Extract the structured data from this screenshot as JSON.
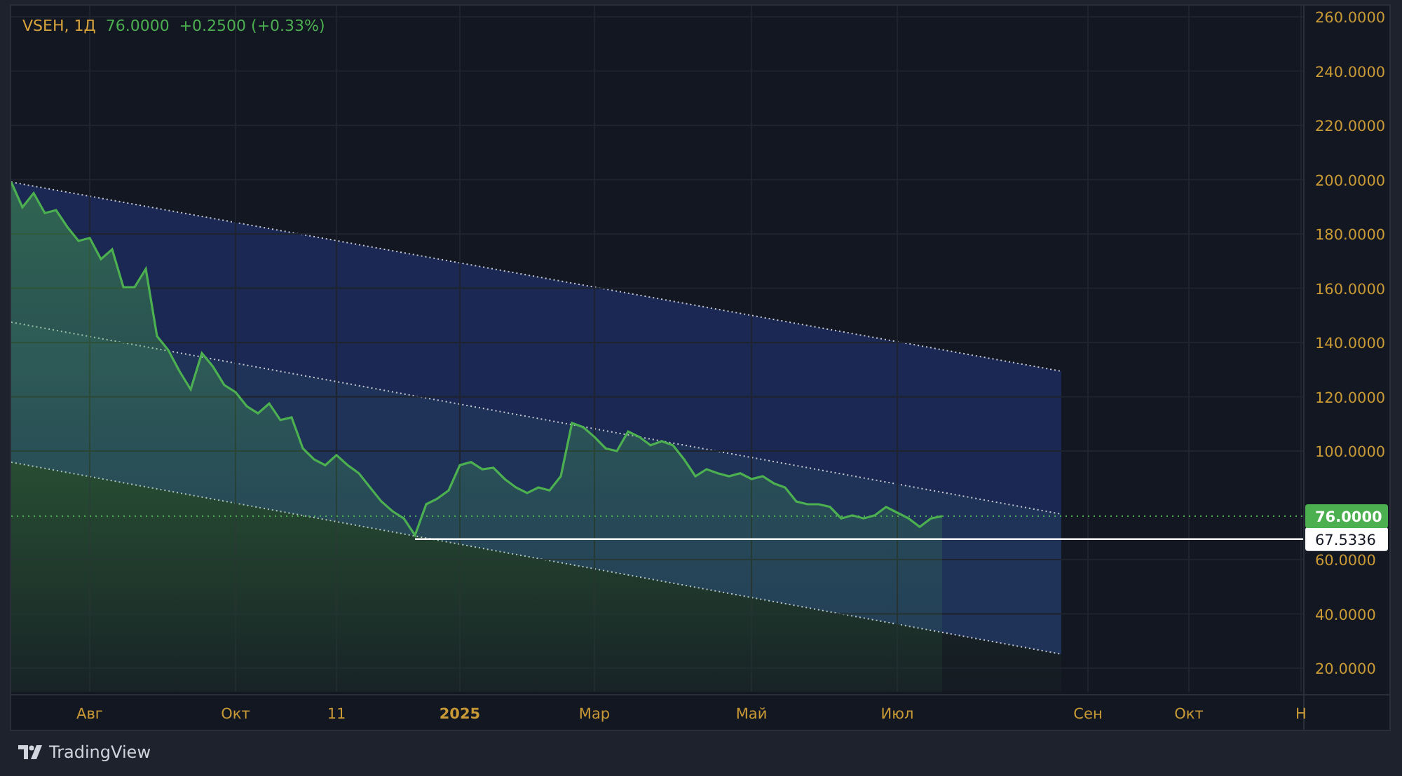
{
  "legend": {
    "symbol": "VSEH, 1Д",
    "price": "76.0000",
    "change": "+0.2500 (+0.33%)"
  },
  "chart": {
    "drawings": [
      {
        "kind": "regression_channel"
      }
    ],
    "chart_data": {
      "type": "area",
      "grid": true,
      "ylim": [
        11.23,
        264.13
      ],
      "yticks": [
        {
          "value": 20,
          "label": "20.0000"
        },
        {
          "value": 40,
          "label": "40.0000"
        },
        {
          "value": 60,
          "label": "60.0000"
        },
        {
          "value": 100,
          "label": "100.0000"
        },
        {
          "value": 120,
          "label": "120.0000"
        },
        {
          "value": 140,
          "label": "140.0000"
        },
        {
          "value": 160,
          "label": "160.0000"
        },
        {
          "value": 180,
          "label": "180.0000"
        },
        {
          "value": 200,
          "label": "200.0000"
        },
        {
          "value": 220,
          "label": "220.0000"
        },
        {
          "value": 240,
          "label": "240.0000"
        },
        {
          "value": 260,
          "label": "260.0000"
        }
      ],
      "categories": [
        null,
        null,
        null,
        null,
        null,
        null,
        null,
        "Авг",
        null,
        null,
        null,
        null,
        null,
        null,
        null,
        null,
        null,
        null,
        null,
        null,
        "Окт",
        null,
        null,
        null,
        null,
        null,
        null,
        null,
        null,
        "11",
        null,
        null,
        null,
        null,
        null,
        null,
        null,
        null,
        null,
        null,
        "2025",
        null,
        null,
        null,
        null,
        null,
        null,
        null,
        null,
        null,
        null,
        null,
        "Мар",
        null,
        null,
        null,
        null,
        null,
        null,
        null,
        null,
        null,
        null,
        null,
        null,
        null,
        "Май",
        null,
        null,
        null,
        null,
        null,
        null,
        null,
        null,
        null,
        null,
        null,
        null,
        "Июл",
        null,
        null,
        null,
        null,
        null,
        null,
        null,
        null,
        null,
        null,
        null,
        null,
        null,
        null,
        null,
        null,
        "Сен",
        null,
        null,
        null,
        null,
        null,
        null,
        null,
        null,
        "Окт",
        null,
        null,
        null,
        null,
        null,
        null,
        null,
        null,
        null,
        "Н"
      ],
      "series": [
        {
          "color": "#4caf50",
          "values": [
            199.1,
            189.8,
            195,
            187.7,
            188.8,
            182.6,
            177.4,
            178.5,
            170.7,
            174.3,
            160.4,
            160.4,
            167.1,
            142.3,
            137.2,
            129.4,
            122.7,
            136.1,
            131,
            124.3,
            121.7,
            116.5,
            113.9,
            117.5,
            111.4,
            112.4,
            101,
            96.9,
            94.8,
            98.5,
            94.8,
            91.8,
            86.6,
            81.4,
            77.8,
            75.2,
            69,
            80.4,
            82.5,
            85.5,
            94.8,
            95.9,
            93.3,
            93.8,
            89.7,
            86.6,
            84.5,
            86.6,
            85.5,
            90.7,
            110.3,
            108.8,
            105.2,
            101,
            100,
            107.2,
            105.2,
            102.1,
            103.6,
            102.1,
            96.9,
            90.7,
            93.3,
            91.8,
            90.7,
            91.8,
            89.7,
            90.7,
            88.1,
            86.6,
            81.4,
            80.4,
            80.4,
            79.4,
            75.2,
            76.3,
            75.2,
            76.3,
            79.4,
            77.3,
            75.2,
            72.1,
            75.2,
            76,
            null,
            null,
            null,
            null,
            null,
            null,
            null,
            null,
            null,
            null,
            null,
            null,
            null,
            null,
            null,
            null,
            null,
            null,
            null,
            null,
            null,
            null,
            null,
            null,
            null,
            null,
            null,
            null,
            null,
            null,
            null,
            null
          ]
        }
      ],
      "ref_lines": [
        {
          "axis": "y",
          "value": 67.5336,
          "label": "67.5336",
          "color": "#ffffff"
        },
        {
          "axis": "y",
          "value": 76,
          "label": "76.0000",
          "color": "#4caf50"
        }
      ]
    }
  },
  "footer": {
    "brand": "TradingView"
  }
}
